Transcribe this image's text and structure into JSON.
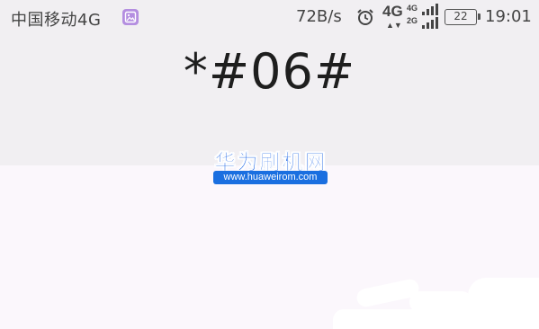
{
  "status_bar": {
    "carrier": "中国移动4G",
    "net_speed": "72B/s",
    "network_4g": "4G",
    "sim_labels": [
      "4G",
      "2G"
    ],
    "battery": "22",
    "time": "19:01"
  },
  "dialer": {
    "code": "*#06#"
  },
  "watermark": {
    "title": "华为刷机网",
    "url": "www.huaweirom.com"
  },
  "colors": {
    "status_bg": "#f1eff2",
    "bottom_bg": "#fbf7fc",
    "watermark_blue": "#1a63e6",
    "photo_icon": "#b48ee0"
  }
}
